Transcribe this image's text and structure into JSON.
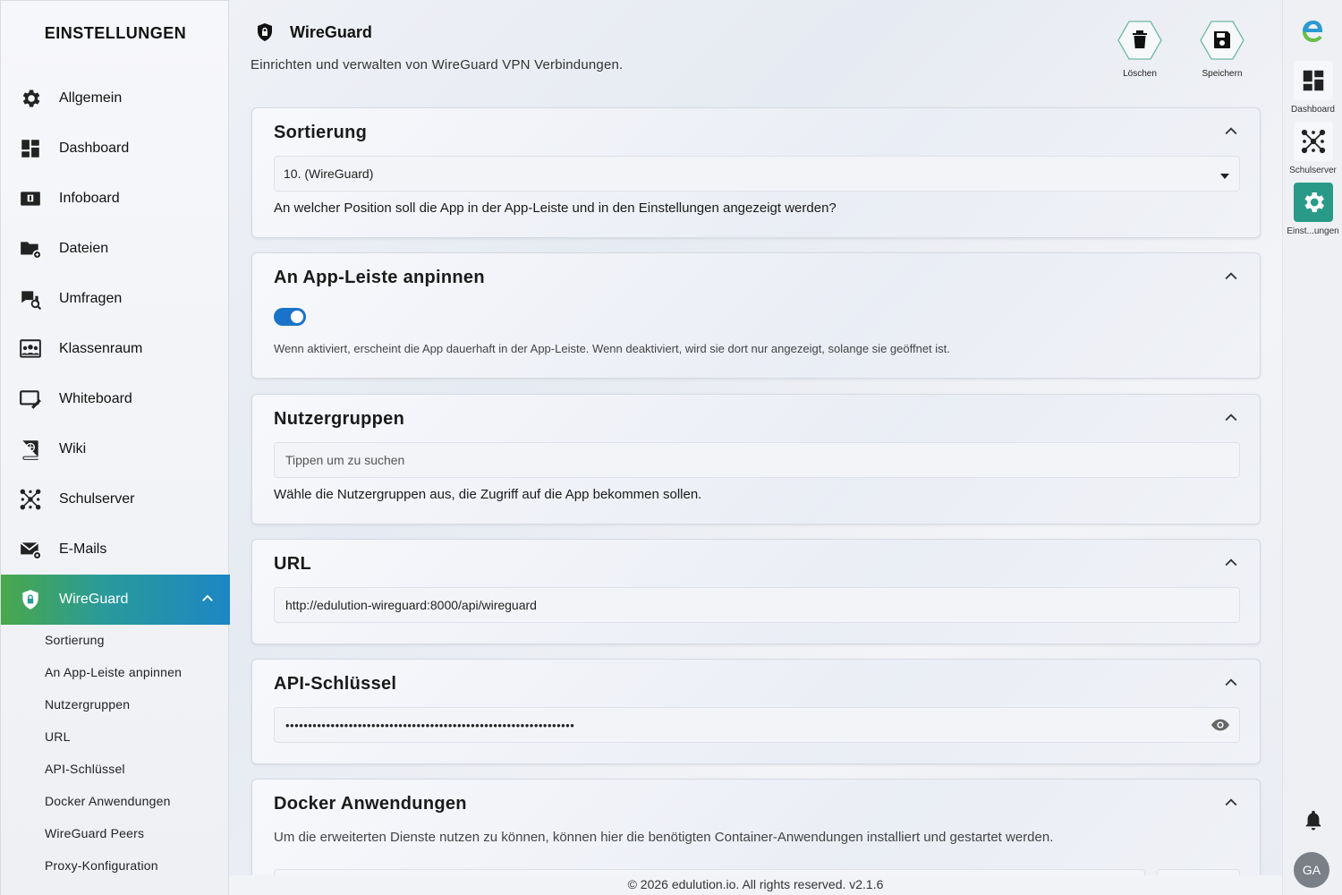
{
  "sidebar": {
    "title": "EINSTELLUNGEN",
    "items": [
      {
        "label": "Allgemein",
        "icon": "gear-icon"
      },
      {
        "label": "Dashboard",
        "icon": "dashboard-icon"
      },
      {
        "label": "Infoboard",
        "icon": "infoboard-icon"
      },
      {
        "label": "Dateien",
        "icon": "folder-icon"
      },
      {
        "label": "Umfragen",
        "icon": "survey-icon"
      },
      {
        "label": "Klassenraum",
        "icon": "classroom-icon"
      },
      {
        "label": "Whiteboard",
        "icon": "whiteboard-icon"
      },
      {
        "label": "Wiki",
        "icon": "wiki-icon"
      },
      {
        "label": "Schulserver",
        "icon": "network-icon"
      },
      {
        "label": "E-Mails",
        "icon": "mail-icon"
      },
      {
        "label": "WireGuard",
        "icon": "shield-icon"
      }
    ],
    "sub_items": [
      "Sortierung",
      "An App-Leiste anpinnen",
      "Nutzergruppen",
      "URL",
      "API-Schlüssel",
      "Docker Anwendungen",
      "WireGuard Peers",
      "Proxy-Konfiguration"
    ]
  },
  "header": {
    "title": "WireGuard",
    "description": "Einrichten und verwalten von WireGuard VPN Verbindungen.",
    "delete_label": "Löschen",
    "save_label": "Speichern"
  },
  "sections": {
    "sortierung": {
      "title": "Sortierung",
      "selected": "10. (WireGuard)",
      "help": "An welcher Position soll die App in der App-Leiste und in den Einstellungen angezeigt werden?"
    },
    "pin": {
      "title": "An App-Leiste anpinnen",
      "enabled": true,
      "help": "Wenn aktiviert, erscheint die App dauerhaft in der App-Leiste. Wenn deaktiviert, wird sie dort nur angezeigt, solange sie geöffnet ist."
    },
    "groups": {
      "title": "Nutzergruppen",
      "placeholder": "Tippen um zu suchen",
      "help": "Wähle die Nutzergruppen aus, die Zugriff auf die App bekommen sollen."
    },
    "url": {
      "title": "URL",
      "value": "http://edulution-wireguard:8000/api/wireguard"
    },
    "api_key": {
      "title": "API-Schlüssel",
      "masked_value": "••••••••••••••••••••••••••••••••••••••••••••••••••••••••••••••••"
    },
    "docker": {
      "title": "Docker Anwendungen",
      "help": "Um die erweiterten Dienste nutzen zu können, können hier die benötigten Container-Anwendungen installiert und gestartet werden."
    }
  },
  "rail": {
    "items": [
      {
        "label": "Dashboard",
        "icon": "dashboard-icon"
      },
      {
        "label": "Schulserver",
        "icon": "network-icon"
      },
      {
        "label": "Einst...ungen",
        "icon": "gear-icon"
      }
    ],
    "avatar_initials": "GA"
  },
  "footer": {
    "text": "© 2026 edulution.io. All rights reserved. v2.1.6"
  },
  "colors": {
    "accent_start": "#4aa84a",
    "accent_end": "#1d86c4",
    "toggle": "#1a73c9",
    "settings_tile": "#2a9a88"
  }
}
